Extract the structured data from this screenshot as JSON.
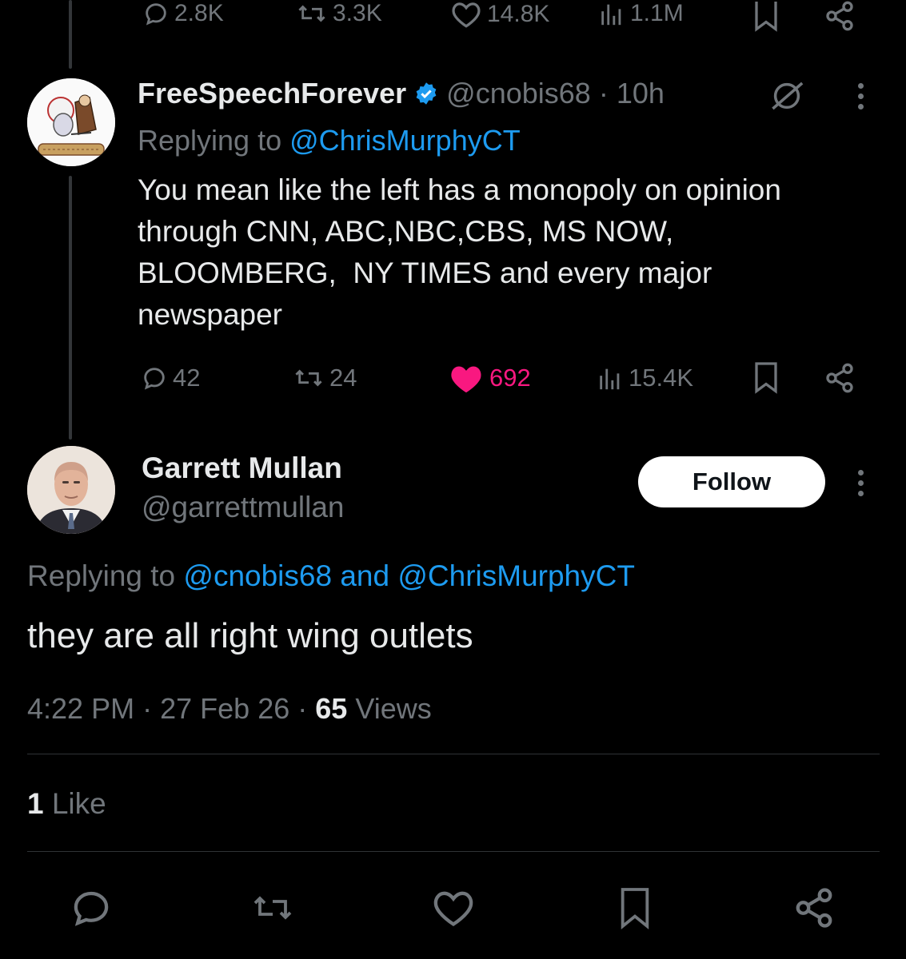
{
  "top_actions": {
    "replies": "2.8K",
    "reposts": "3.3K",
    "likes": "14.8K",
    "views": "1.1M"
  },
  "tweet1": {
    "display_name": "FreeSpeechForever",
    "handle": "@cnobis68",
    "separator": "·",
    "time": "10h",
    "replying_prefix": "Replying to",
    "replying_to": "@ChrisMurphyCT",
    "body_lines": [
      "You mean like the left has a monopoly on opinion",
      "through CNN, ABC,NBC,CBS, MS NOW,",
      "BLOOMBERG,  NY TIMES and every major",
      "newspaper"
    ],
    "actions": {
      "replies": "42",
      "reposts": "24",
      "likes": "692",
      "views": "15.4K"
    }
  },
  "tweet2": {
    "display_name": "Garrett Mullan",
    "handle": "@garrettmullan",
    "follow_label": "Follow",
    "replying_prefix": "Replying to",
    "replying_to_1": "@cnobis68",
    "replying_and": "and",
    "replying_to_2": "@ChrisMurphyCT",
    "body": "they are all right wing outlets",
    "time": "4:22 PM",
    "dot": "·",
    "date": "27 Feb 26",
    "views_count": "65",
    "views_label": "Views",
    "like_count": "1",
    "like_label": "Like"
  },
  "colors": {
    "background": "#000000",
    "text": "#e7e9ea",
    "muted": "#71767b",
    "link": "#1d9bf0",
    "verified": "#1d9bf0",
    "liked": "#f91880"
  }
}
